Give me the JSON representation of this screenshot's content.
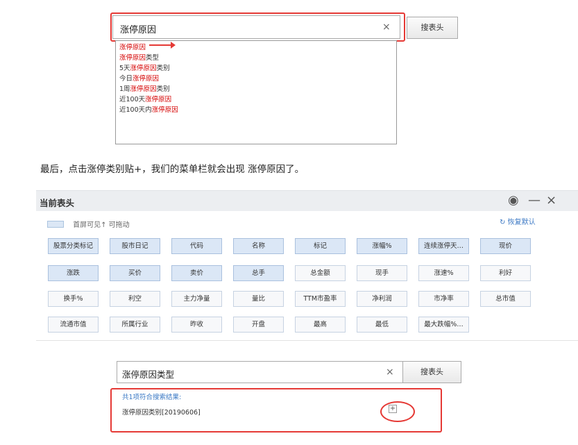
{
  "search1": {
    "query": "涨停原因",
    "clear_icon": "×",
    "button": "搜表头",
    "suggestions": [
      {
        "pre": "",
        "hit": "涨停原因",
        "post": ""
      },
      {
        "pre": "",
        "hit": "涨停原因",
        "post": "类型"
      },
      {
        "pre": "5天",
        "hit": "涨停原因",
        "post": "类别"
      },
      {
        "pre": "今日",
        "hit": "涨停原因",
        "post": ""
      },
      {
        "pre": "1周",
        "hit": "涨停原因",
        "post": "类别"
      },
      {
        "pre": "近100天",
        "hit": "涨停原因",
        "post": ""
      },
      {
        "pre": "近100天内",
        "hit": "涨停原因",
        "post": ""
      }
    ]
  },
  "instruction": "最后，点击涨停类别贴+，我们的菜单栏就会出现 涨停原因了。",
  "dialog": {
    "title": "当前表头",
    "icons": {
      "info": "◉",
      "minimize": "—",
      "close": "×"
    },
    "drag_hint": "首屏可见↑ 可拖动",
    "restore_icon": "↻",
    "restore_label": "恢复默认",
    "chips": [
      {
        "label": "股票分类标记",
        "style": "b"
      },
      {
        "label": "股市日记",
        "style": "b"
      },
      {
        "label": "代码",
        "style": "b"
      },
      {
        "label": "名称",
        "style": "b"
      },
      {
        "label": "标记",
        "style": "b"
      },
      {
        "label": "涨幅%",
        "style": "b"
      },
      {
        "label": "连续涨停天…",
        "style": "b"
      },
      {
        "label": "现价",
        "style": "b"
      },
      {
        "label": "涨跌",
        "style": "b"
      },
      {
        "label": "买价",
        "style": "b"
      },
      {
        "label": "卖价",
        "style": "b"
      },
      {
        "label": "总手",
        "style": "b"
      },
      {
        "label": "总金额",
        "style": "w"
      },
      {
        "label": "现手",
        "style": "w"
      },
      {
        "label": "涨速%",
        "style": "w"
      },
      {
        "label": "利好",
        "style": "w"
      },
      {
        "label": "换手%",
        "style": "w"
      },
      {
        "label": "利空",
        "style": "w"
      },
      {
        "label": "主力净量",
        "style": "w"
      },
      {
        "label": "量比",
        "style": "w"
      },
      {
        "label": "TTM市盈率",
        "style": "w"
      },
      {
        "label": "净利润",
        "style": "w"
      },
      {
        "label": "市净率",
        "style": "w"
      },
      {
        "label": "总市值",
        "style": "w"
      },
      {
        "label": "流通市值",
        "style": "w"
      },
      {
        "label": "所属行业",
        "style": "w"
      },
      {
        "label": "昨收",
        "style": "w"
      },
      {
        "label": "开盘",
        "style": "w"
      },
      {
        "label": "最高",
        "style": "w"
      },
      {
        "label": "最低",
        "style": "w"
      },
      {
        "label": "最大跌幅%…",
        "style": "w"
      }
    ]
  },
  "search2": {
    "query": "涨停原因类型",
    "clear_icon": "×",
    "button": "搜表头",
    "result_count": "共1项符合搜索结果:",
    "result_item": "涨停原因类别[20190606]",
    "add_icon": "+"
  },
  "colors": {
    "highlight": "#e53935",
    "hit_text": "#d50000",
    "link": "#3b78c4",
    "chip_blue": "#dbe7f6"
  }
}
